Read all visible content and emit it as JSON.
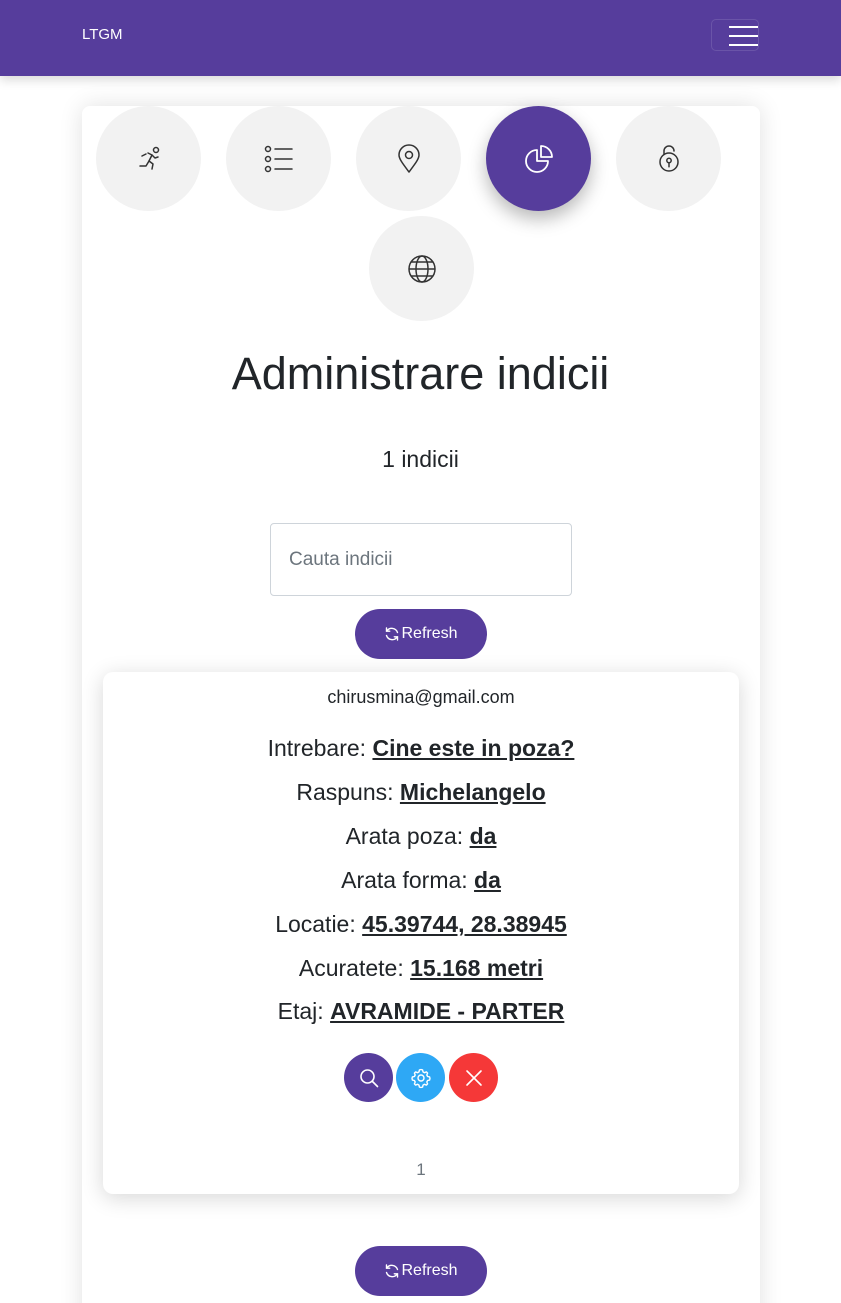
{
  "navbar": {
    "brand": "LTGM",
    "menu_icon": "hamburger-icon"
  },
  "nav_circles": [
    {
      "icon": "running-person-icon",
      "active": false
    },
    {
      "icon": "list-icon",
      "active": false
    },
    {
      "icon": "location-pin-icon",
      "active": false
    },
    {
      "icon": "pie-chart-icon",
      "active": true
    },
    {
      "icon": "unlock-icon",
      "active": false
    },
    {
      "icon": "globe-icon",
      "active": false
    }
  ],
  "page": {
    "title": "Administrare indicii",
    "count_text": "1 indicii",
    "search_placeholder": "Cauta indicii",
    "refresh_label": "Refresh"
  },
  "item": {
    "email": "chirusmina@gmail.com",
    "fields": [
      {
        "label": "Intrebare: ",
        "value": "Cine este in poza?"
      },
      {
        "label": "Raspuns: ",
        "value": "Michelangelo"
      },
      {
        "label": "Arata poza: ",
        "value": "da"
      },
      {
        "label": "Arata forma: ",
        "value": "da"
      },
      {
        "label": "Locatie: ",
        "value": "45.39744, 28.38945"
      },
      {
        "label": "Acuratete: ",
        "value": "15.168 metri"
      },
      {
        "label": "Etaj: ",
        "value": "AVRAMIDE - PARTER"
      }
    ],
    "actions": [
      {
        "icon": "search-icon",
        "color": "#563d9c"
      },
      {
        "icon": "gear-icon",
        "color": "#2ea8f5"
      },
      {
        "icon": "close-icon",
        "color": "#f53838"
      }
    ],
    "page_number": "1"
  },
  "colors": {
    "primary": "#563d9c",
    "info": "#2ea8f5",
    "danger": "#f53838",
    "circle_bg": "#f2f2f2"
  }
}
